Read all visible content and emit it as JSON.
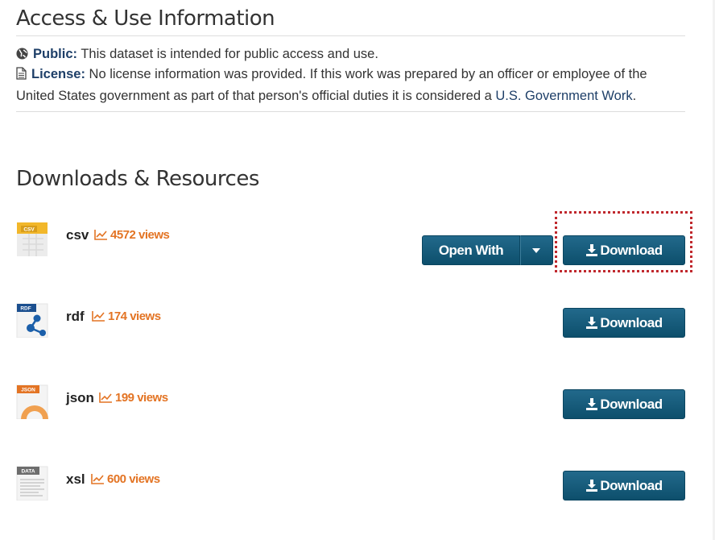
{
  "access": {
    "title": "Access & Use Information",
    "public_label": "Public:",
    "public_text": "This dataset is intended for public access and use.",
    "license_label": "License:",
    "license_text_1": "No license information was provided. If this work was prepared by an officer or employee of the",
    "license_text_2": "United States government as part of that person's official duties it is considered a",
    "license_link": "U.S. Government Work",
    "license_end": "."
  },
  "downloads": {
    "title": "Downloads & Resources",
    "open_with_label": "Open With",
    "resources": [
      {
        "format": "csv",
        "views": "4572 views",
        "download_label": "Download",
        "icon": "csv-file-icon"
      },
      {
        "format": "rdf",
        "views": "174 views",
        "download_label": "Download",
        "icon": "rdf-file-icon"
      },
      {
        "format": "json",
        "views": "199 views",
        "download_label": "Download",
        "icon": "json-file-icon"
      },
      {
        "format": "xsl",
        "views": "600 views",
        "download_label": "Download",
        "icon": "data-file-icon"
      }
    ],
    "icon_labels": {
      "csv": "CSV",
      "rdf": "RDF",
      "json": "JSON",
      "data": "DATA"
    }
  },
  "colors": {
    "button": "#0d4f6c",
    "views": "#e37424",
    "link": "#1e3f68",
    "focus": "#c0282d"
  }
}
